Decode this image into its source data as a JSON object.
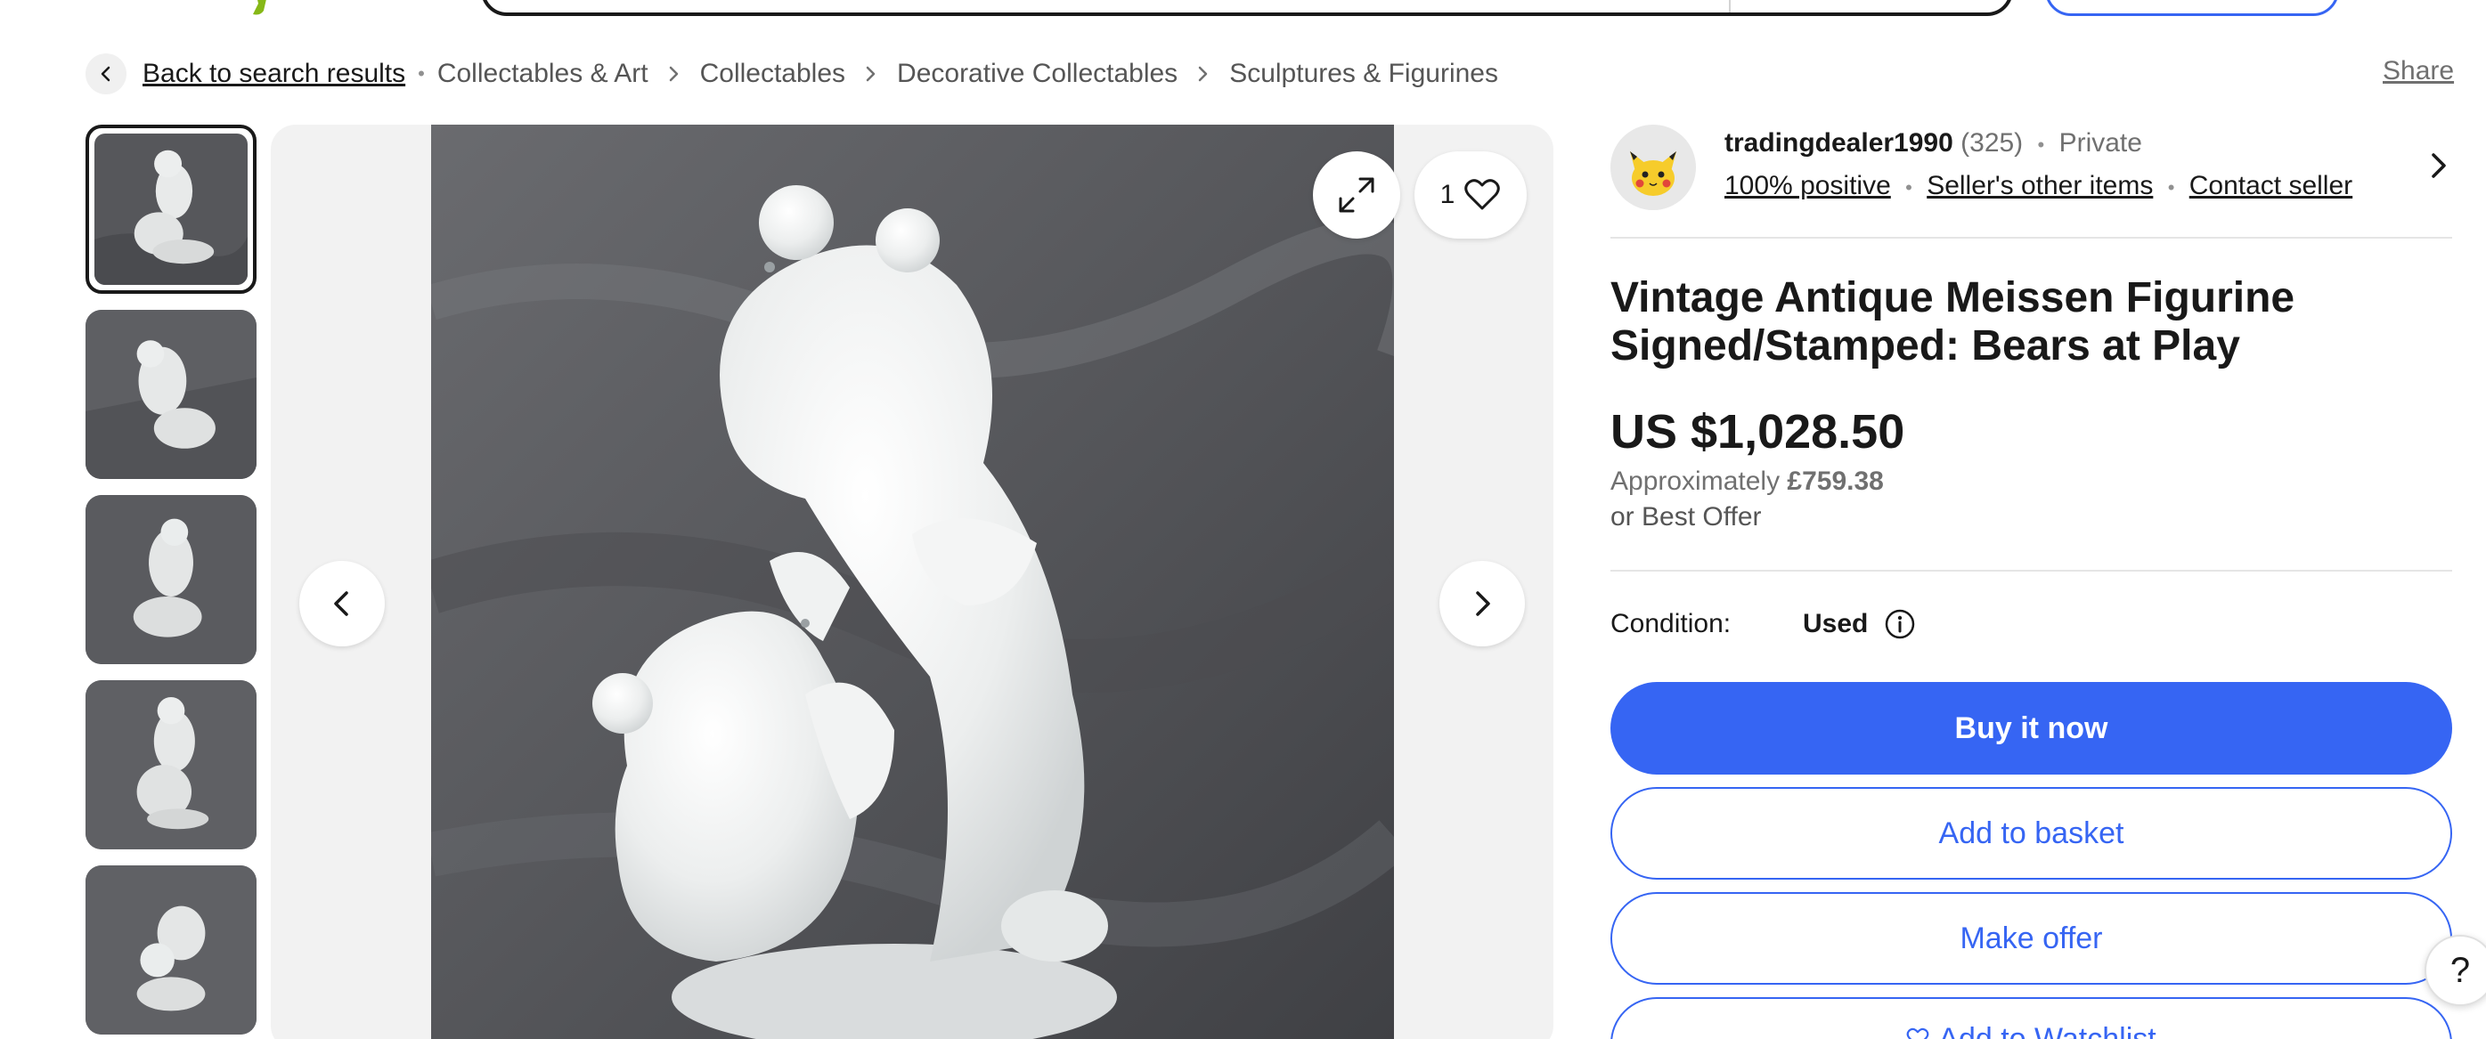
{
  "colors": {
    "accent": "#3665f3",
    "text": "#191919",
    "muted": "#707070",
    "logo_green": "#86b817"
  },
  "breadcrumb": {
    "back_label": "Back to search results",
    "items": [
      "Collectables & Art",
      "Collectables",
      "Decorative Collectables",
      "Sculptures & Figurines"
    ],
    "share_label": "Share"
  },
  "gallery": {
    "thumbnail_count": 5,
    "selected_thumbnail": 1,
    "watch_count": "1",
    "icons": [
      "expand-icon",
      "heart-icon",
      "chevron-left-icon",
      "chevron-right-icon"
    ]
  },
  "seller": {
    "name": "tradingdealer1990",
    "feedback_count": "(325)",
    "type": "Private",
    "positive": "100% positive",
    "other_items": "Seller's other items",
    "contact": "Contact seller"
  },
  "listing": {
    "title": "Vintage Antique Meissen Figurine Signed/Stamped: Bears at Play",
    "price": "US $1,028.50",
    "approx_label": "Approximately",
    "approx_value": "£759.38",
    "best_offer": "or Best Offer",
    "condition_label": "Condition:",
    "condition_value": "Used"
  },
  "actions": {
    "buy_now": "Buy it now",
    "add_basket": "Add to basket",
    "make_offer": "Make offer",
    "watchlist": "Add to Watchlist"
  },
  "help": {
    "label": "?"
  }
}
